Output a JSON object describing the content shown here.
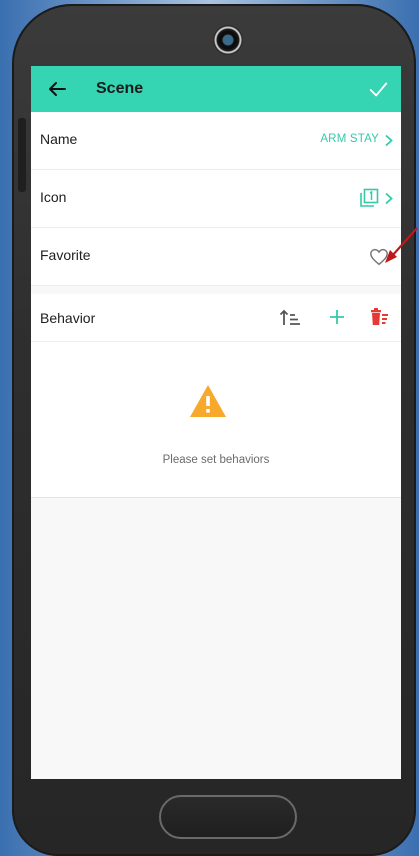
{
  "appbar": {
    "title": "Scene"
  },
  "rows": {
    "name": {
      "label": "Name",
      "value": "ARM STAY"
    },
    "icon": {
      "label": "Icon",
      "value_icon": "scene-icon-1"
    },
    "favorite": {
      "label": "Favorite",
      "value_icon": "heart-outline-icon"
    }
  },
  "behavior": {
    "label": "Behavior",
    "actions": [
      "sort-icon",
      "add-icon",
      "delete-icon"
    ]
  },
  "empty_state": {
    "icon": "warning-icon",
    "message": "Please set behaviors"
  },
  "colors": {
    "accent": "#35d4b2",
    "value_text": "#35c9a9",
    "delete": "#e53935",
    "warning": "#f7a92c",
    "annotation_arrow": "#c0171b"
  }
}
